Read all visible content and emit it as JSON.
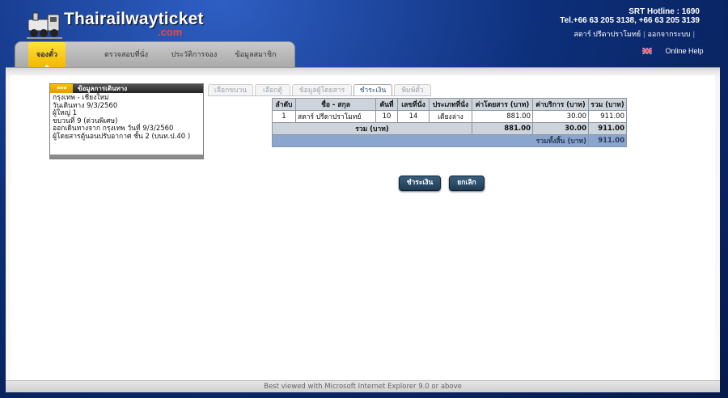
{
  "brand": {
    "logo_text": "Thairailwayticket",
    "logo_suffix": ".com"
  },
  "hotline": {
    "line1": "SRT Hotline : 1690",
    "line2": "Tel.+66 63 205 3138, +66 63 205 3139"
  },
  "user": {
    "name": "สตาร์ ปรีดาปราโมทย์",
    "separator": "|",
    "logout": "ออกจากระบบ",
    "trailing_sep": "|"
  },
  "nav": {
    "items": [
      {
        "label": "จองตั๋ว",
        "active": true
      },
      {
        "label": "ตรวจสอบที่นั่ง",
        "active": false
      },
      {
        "label": "ประวัติการจอง",
        "active": false
      },
      {
        "label": "ข้อมูลสมาชิก",
        "active": false
      }
    ]
  },
  "lang": {
    "help": "Online Help",
    "flag_icon": "uk-flag-icon"
  },
  "trip": {
    "chevrons": "»»»",
    "title": "ข้อมูลการเดินทาง",
    "lines": [
      "กรุงเทพ - เชียงใหม่",
      "วันเดินทาง 9/3/2560",
      "ผู้ใหญ่ 1",
      "ขบวนที่ 9 (ด่วนพิเศษ)",
      "ออกเดินทางจาก กรุงเทพ วันที่ 9/3/2560",
      "ผู้โดยสารตู้นอนปรับอากาศ ชั้น 2 (บนท.ป.40 )"
    ]
  },
  "steps": [
    {
      "label": "เลือกขบวน",
      "active": false
    },
    {
      "label": "เลือกตู้",
      "active": false
    },
    {
      "label": "ข้อมูลผู้โดยสาร",
      "active": false
    },
    {
      "label": "ชำระเงิน",
      "active": true
    },
    {
      "label": "พิมพ์ตั๋ว",
      "active": false
    }
  ],
  "table": {
    "headers": [
      "ลำดับ",
      "ชื่อ - สกุล",
      "คันที่",
      "เลขที่นั่ง",
      "ประเภทที่นั่ง",
      "ค่าโดยสาร (บาท)",
      "ค่าบริการ (บาท)",
      "รวม (บาท)"
    ],
    "rows": [
      [
        "1",
        "สตาร์ ปรีดาปราโมทย์",
        "10",
        "14",
        "เตียงล่าง",
        "881.00",
        "30.00",
        "911.00"
      ]
    ],
    "sum": {
      "label": "รวม (บาท)",
      "fare": "881.00",
      "service": "30.00",
      "total": "911.00"
    },
    "grand": {
      "label": "รวมทั้งสิ้น (บาท)",
      "total": "911.00"
    }
  },
  "buttons": {
    "pay": "ชำระเงิน",
    "cancel": "ยกเลิก"
  },
  "footer": {
    "text": "Best viewed with Microsoft Internet Explorer 9.0 or above"
  },
  "colors": {
    "accent_yellow": "#f2b600",
    "header_blue": "#0d2f7a",
    "table_head": "#cdd4dc",
    "grand_row": "#8aa6cf"
  }
}
